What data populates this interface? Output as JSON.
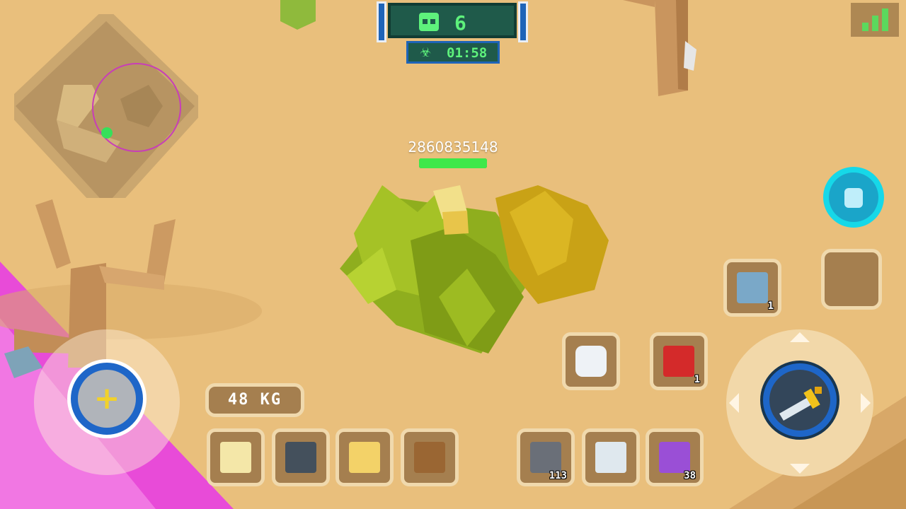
{
  "hud": {
    "players_alive": "6",
    "players_icon": "skull-icon",
    "timer": "01:58",
    "timer_icon": "biohazard-icon",
    "signal_icon": "signal-bars-icon"
  },
  "player": {
    "name": "2860835148",
    "health_fraction": 1.0
  },
  "inventory": {
    "weight": "48 KG",
    "gear_slots": [
      {
        "name": "helmet-slot",
        "icon": "helmet-icon"
      },
      {
        "name": "armor-slot",
        "icon": "vest-icon"
      },
      {
        "name": "pants-slot",
        "icon": "pants-icon"
      },
      {
        "name": "backpack-slot",
        "icon": "crate-icon"
      }
    ],
    "item_slots": [
      {
        "name": "ammo-slot",
        "icon": "ammo-icon",
        "count": "113"
      },
      {
        "name": "sword-slot",
        "icon": "sword-icon",
        "count": ""
      },
      {
        "name": "gun-slot",
        "icon": "purple-gun-icon",
        "count": "38"
      }
    ]
  },
  "actions": {
    "chat_icon": "chat-bubble-icon",
    "bomb_icon": "tnt-bomb-icon",
    "bomb_count": "1",
    "device_icon": "tablet-device-icon",
    "device_count": "1",
    "backpack_icon": "backpack-icon",
    "empty_slot": "empty-slot",
    "attack_icon": "sword-icon",
    "joystick_icon": "plus-icon"
  },
  "colors": {
    "sand": "#e9bf7c",
    "hud_green": "#5ef27c",
    "hud_blue": "#1e66c8",
    "health_green": "#3ee84a",
    "slot_brown": "#a57f4f",
    "slot_border": "#f0d9ad",
    "poison_zone": "#e84bd8"
  }
}
